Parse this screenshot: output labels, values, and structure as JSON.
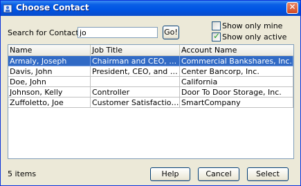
{
  "window": {
    "title": "Choose Contact"
  },
  "search": {
    "label": "Search for Contact:",
    "value": "jo",
    "go_label": "Go!"
  },
  "filters": [
    {
      "label": "Show only mine",
      "checked": false
    },
    {
      "label": "Show only active",
      "checked": true
    }
  ],
  "table": {
    "columns": [
      "Name",
      "Job Title",
      "Account Name"
    ],
    "rows": [
      {
        "name": "Armaly, Joseph",
        "job_title": "Chairman and CEO, Commercial Bankshares, Inc.",
        "account": "Commercial Bankshares, Inc.",
        "selected": true
      },
      {
        "name": "Davis, John",
        "job_title": "President, CEO, and Director;",
        "account": "Center Bancorp, Inc.",
        "selected": false
      },
      {
        "name": "Doe, John",
        "job_title": "",
        "account": "California",
        "selected": false
      },
      {
        "name": "Johnson, Kelly",
        "job_title": "Controller",
        "account": "Door To Door Storage, Inc.",
        "selected": false
      },
      {
        "name": "Zuffoletto, Joe",
        "job_title": "Customer Satisfaction Rep",
        "account": "SmartCompany",
        "selected": false
      }
    ]
  },
  "status": {
    "count_text": "5 items"
  },
  "buttons": {
    "help": "Help",
    "cancel": "Cancel",
    "select": "Select"
  }
}
